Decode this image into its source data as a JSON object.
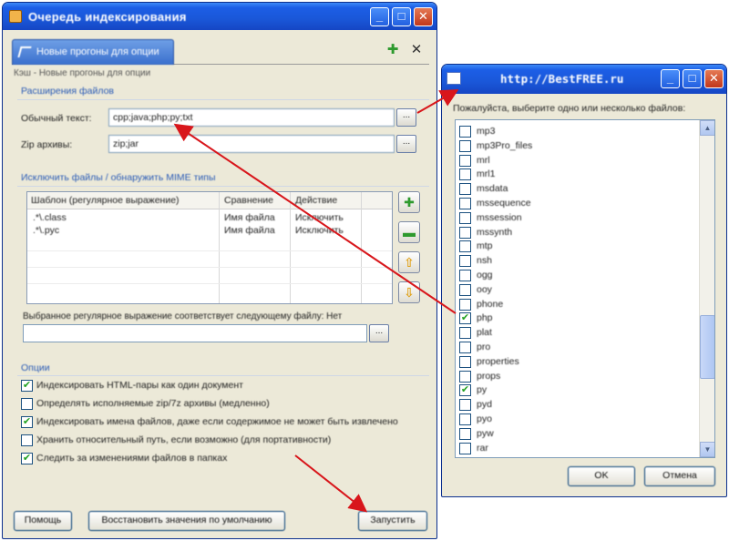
{
  "main_window": {
    "title": "Очередь индексирования",
    "controls": {
      "minimize": "_",
      "maximize": "□",
      "close": "✕"
    },
    "tab_label": "Новые прогоны для опции",
    "breadcrumb": "Кэш - Новые прогоны для опции",
    "extensions_group": {
      "label": "Расширения файлов",
      "plain_text_label": "Обычный текст:",
      "plain_text_value": "cpp;java;php;py;txt",
      "zip_label": "Zip архивы:",
      "zip_value": "zip;jar",
      "browse_label": "..."
    },
    "exclude_group": {
      "label": "Исключить файлы / обнаружить MIME типы",
      "columns": [
        "Шаблон (регулярное выражение)",
        "Сравнение",
        "Действие"
      ],
      "rows": [
        [
          ".*\\.class",
          "Имя файла",
          "Исключить"
        ],
        [
          ".*\\.pyc",
          "Имя файла",
          "Исключить"
        ]
      ],
      "regex_label": "Выбранное регулярное выражение соответствует следующему файлу: Нет",
      "regex_value": ""
    },
    "options_group": {
      "label": "Опции",
      "checks": [
        {
          "label": "Индексировать HTML-пары как один документ",
          "checked": true
        },
        {
          "label": "Определять исполняемые zip/7z архивы (медленно)",
          "checked": false
        },
        {
          "label": "Индексировать имена файлов, даже если содержимое не может быть извлечено",
          "checked": true
        },
        {
          "label": "Хранить относительный путь, если возможно (для портативности)",
          "checked": false
        },
        {
          "label": "Следить за изменениями файлов в папках",
          "checked": true
        }
      ]
    },
    "buttons": {
      "help": "Помощь",
      "restore_defaults": "Восстановить значения по умолчанию",
      "run": "Запустить"
    }
  },
  "picker_window": {
    "title": "http://BestFREE.ru",
    "controls": {
      "minimize": "_",
      "maximize": "□",
      "close": "✕"
    },
    "prompt": "Пожалуйста, выберите одно или несколько файлов:",
    "items": [
      {
        "label": "mp3",
        "checked": false
      },
      {
        "label": "mp3Pro_files",
        "checked": false
      },
      {
        "label": "mrl",
        "checked": false
      },
      {
        "label": "mrl1",
        "checked": false
      },
      {
        "label": "msdata",
        "checked": false
      },
      {
        "label": "mssequence",
        "checked": false
      },
      {
        "label": "mssession",
        "checked": false
      },
      {
        "label": "mssynth",
        "checked": false
      },
      {
        "label": "mtp",
        "checked": false
      },
      {
        "label": "nsh",
        "checked": false
      },
      {
        "label": "ogg",
        "checked": false
      },
      {
        "label": "ooy",
        "checked": false
      },
      {
        "label": "phone",
        "checked": false
      },
      {
        "label": "php",
        "checked": true
      },
      {
        "label": "plat",
        "checked": false
      },
      {
        "label": "pro",
        "checked": false
      },
      {
        "label": "properties",
        "checked": false
      },
      {
        "label": "props",
        "checked": false
      },
      {
        "label": "py",
        "checked": true
      },
      {
        "label": "pyd",
        "checked": false
      },
      {
        "label": "pyo",
        "checked": false
      },
      {
        "label": "pyw",
        "checked": false
      },
      {
        "label": "rar",
        "checked": false
      }
    ],
    "buttons": {
      "ok": "OK",
      "cancel": "Отмена"
    }
  },
  "colors": {
    "annotation_arrow": "#d8161b",
    "title_bar": "#1c5ee6",
    "accent_green": "#21a121"
  }
}
